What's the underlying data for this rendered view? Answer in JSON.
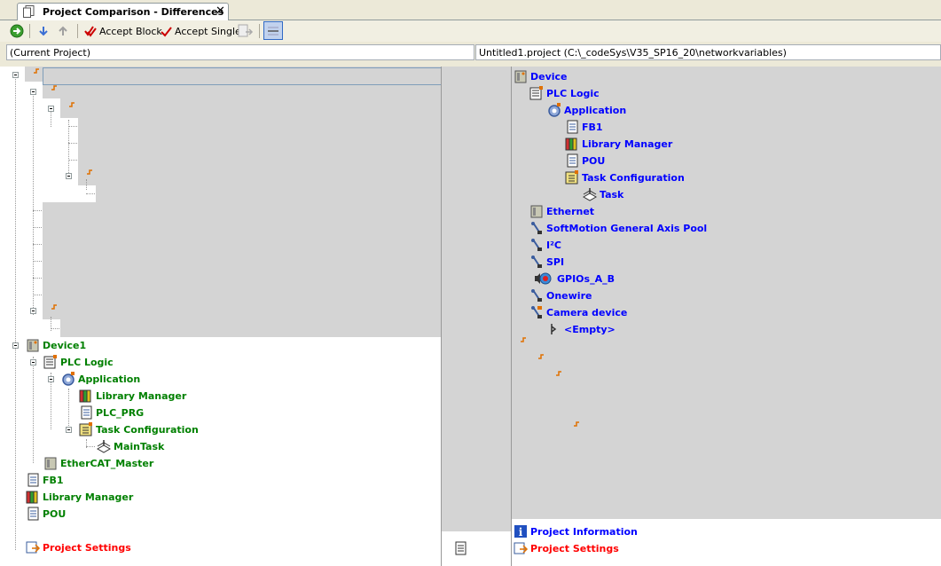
{
  "tab": {
    "title": "Project Comparison - Differences",
    "close": "✕"
  },
  "toolbar": {
    "accept_block": "Accept Block",
    "accept_single": "Accept Single"
  },
  "paths": {
    "left": "(Current Project)",
    "right": "Untitled1.project (C:\\_codeSys\\V35_SP16_20\\networkvariables)"
  },
  "left_tree": {
    "device": "Device1",
    "plc_logic": "PLC Logic",
    "application": "Application",
    "library_manager": "Library Manager",
    "plc_prg": "PLC_PRG",
    "task_configuration": "Task Configuration",
    "main_task": "MainTask",
    "ethercat_master": "EtherCAT_Master",
    "fb1": "FB1",
    "library_manager_root": "Library Manager",
    "pou": "POU",
    "project_settings": "Project Settings"
  },
  "right_tree": {
    "device": "Device",
    "plc_logic": "PLC Logic",
    "application": "Application",
    "fb1": "FB1",
    "library_manager": "Library Manager",
    "pou": "POU",
    "task_configuration": "Task Configuration",
    "task": "Task",
    "ethernet": "Ethernet",
    "softmotion": "SoftMotion General Axis Pool",
    "i2c": "I²C",
    "spi": "SPI",
    "gpios": "GPIOs_A_B",
    "onewire": "Onewire",
    "camera_device": "Camera device",
    "empty": "<Empty>",
    "project_information": "Project Information",
    "project_settings": "Project Settings"
  },
  "colors": {
    "equal": "#008000",
    "changed": "#0000ff",
    "different": "#ff0000",
    "gray_block": "#d4d4d4"
  }
}
